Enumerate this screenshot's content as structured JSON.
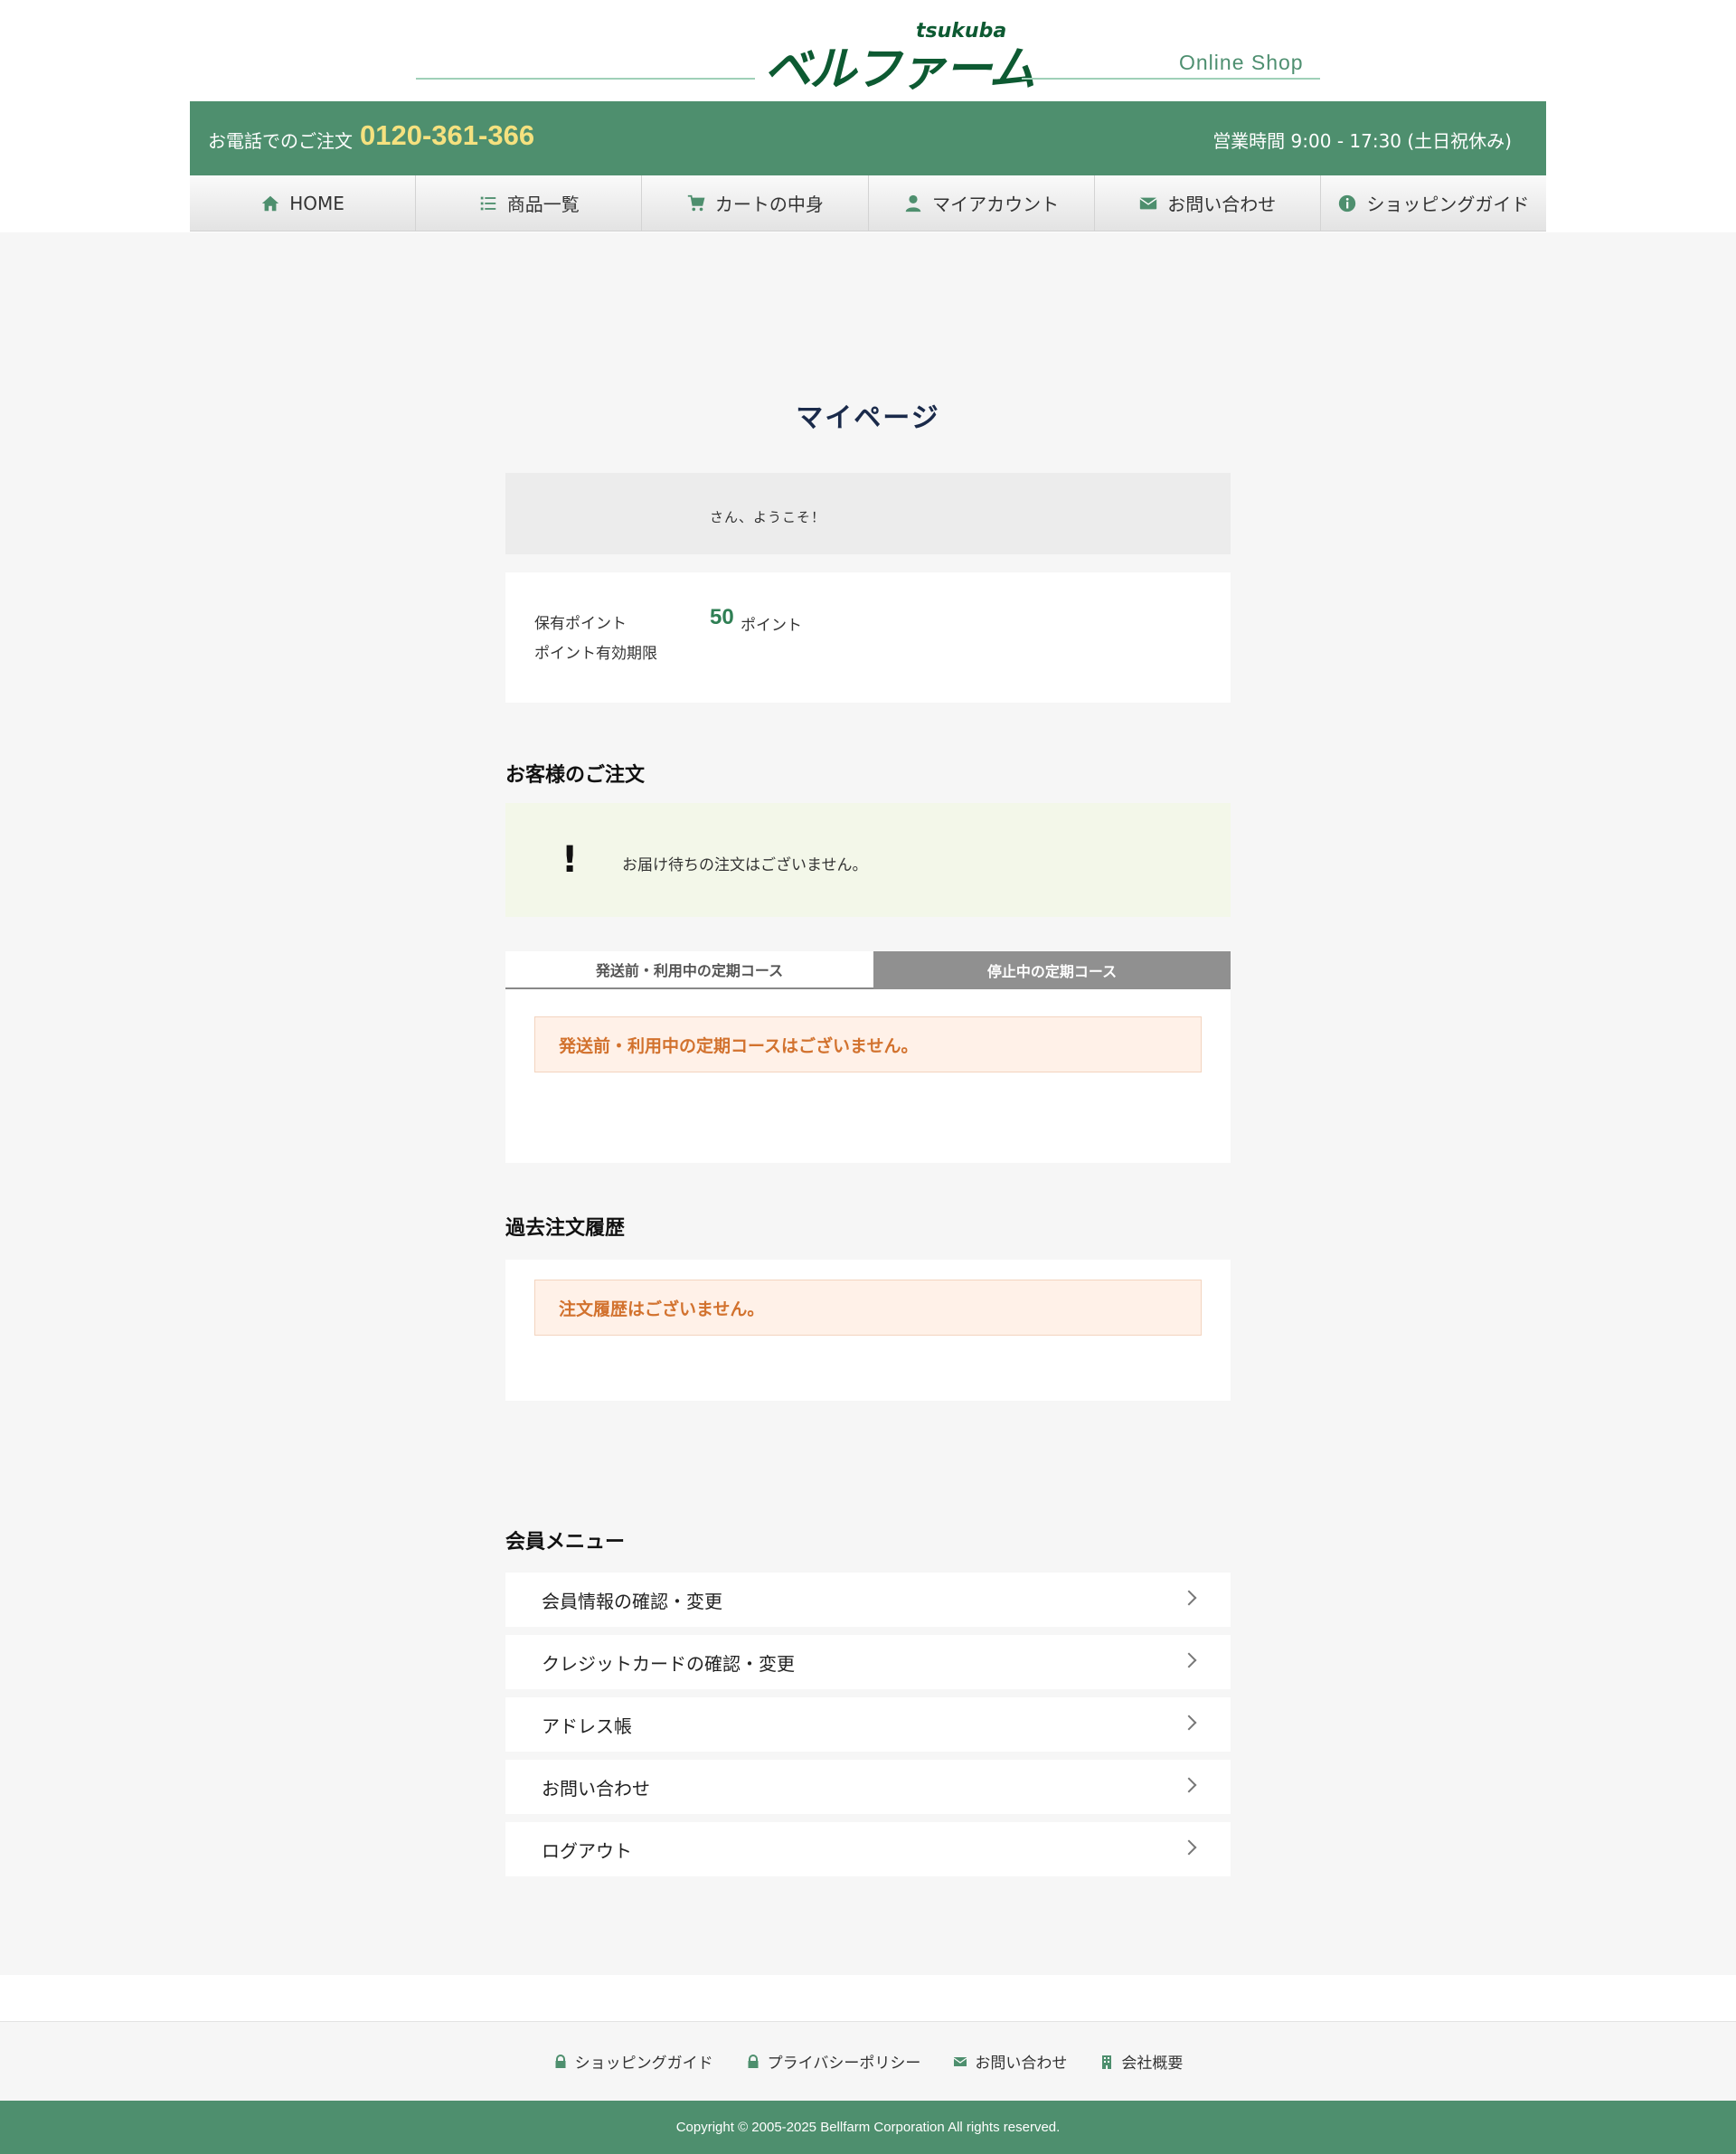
{
  "header": {
    "logo_text": "ベルファーム",
    "logo_sub": "tsukuba",
    "online_shop": "Online  Shop"
  },
  "phone_bar": {
    "label": "お電話でのご注文",
    "number": "0120-361-366",
    "hours": "営業時間 9:00 - 17:30 (土日祝休み)"
  },
  "nav": {
    "items": [
      {
        "label": "HOME",
        "icon": "home-icon"
      },
      {
        "label": "商品一覧",
        "icon": "list-icon"
      },
      {
        "label": "カートの中身",
        "icon": "cart-icon"
      },
      {
        "label": "マイアカウント",
        "icon": "user-icon"
      },
      {
        "label": "お問い合わせ",
        "icon": "mail-icon"
      },
      {
        "label": "ショッピングガイド",
        "icon": "info-icon"
      }
    ]
  },
  "main": {
    "title": "マイページ",
    "welcome": "さん、ようこそ！",
    "points": {
      "label": "保有ポイント",
      "value": "50",
      "unit": "ポイント",
      "expire_label": "ポイント有効期限"
    },
    "orders": {
      "title": "お客様のご注文",
      "notice_mark": "!",
      "notice": "お届け待ちの注文はございません。"
    },
    "subscription": {
      "tab_active": "発送前・利用中の定期コース",
      "tab_inactive": "停止中の定期コース",
      "empty": "発送前・利用中の定期コースはございません。"
    },
    "history": {
      "title": "過去注文履歴",
      "empty": "注文履歴はございません。"
    },
    "member_menu": {
      "title": "会員メニュー",
      "items": [
        "会員情報の確認・変更",
        "クレジットカードの確認・変更",
        "アドレス帳",
        "お問い合わせ",
        "ログアウト"
      ]
    }
  },
  "footer": {
    "links": [
      {
        "label": "ショッピングガイド",
        "icon": "lock-icon"
      },
      {
        "label": "プライバシーポリシー",
        "icon": "lock-icon"
      },
      {
        "label": "お問い合わせ",
        "icon": "mail-icon"
      },
      {
        "label": "会社概要",
        "icon": "building-icon"
      }
    ],
    "copyright": "Copyright © 2005-2025 Bellfarm Corporation All rights reserved."
  },
  "colors": {
    "brand_green": "#4e8f6e",
    "logo_green": "#0d5a32",
    "phone_yellow": "#f5e17f",
    "alert_orange": "#d2722e"
  }
}
